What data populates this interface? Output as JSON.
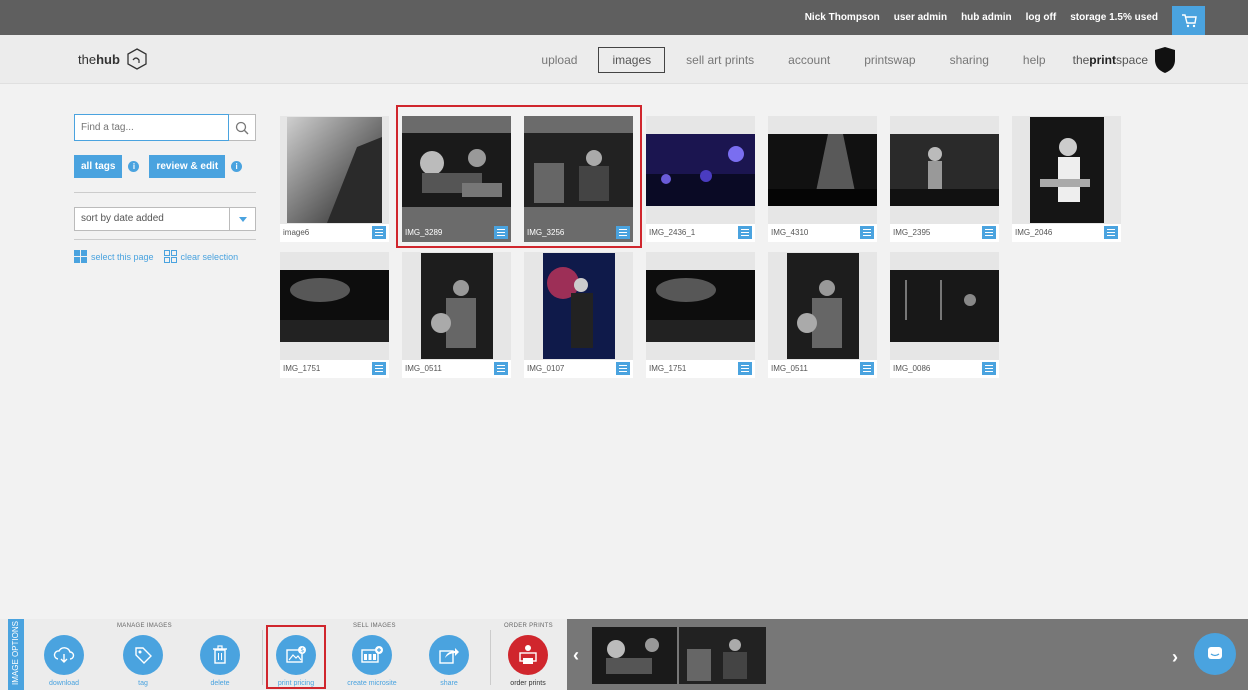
{
  "topbar": {
    "user": "Nick Thompson",
    "user_admin": "user admin",
    "hub_admin": "hub admin",
    "log_off": "log off",
    "storage": "storage 1.5% used",
    "cart_icon": "cart-icon"
  },
  "header": {
    "logo_prefix": "the",
    "logo_bold": "hub",
    "nav": [
      "upload",
      "images",
      "sell art prints",
      "account",
      "printswap",
      "sharing",
      "help"
    ],
    "active_nav": "images",
    "brand_prefix": "the",
    "brand_bold": "print",
    "brand_suffix": "space"
  },
  "sidebar": {
    "search_placeholder": "Find a tag...",
    "all_tags": "all tags",
    "review_edit": "review & edit",
    "sort_value": "sort by date added",
    "select_page": "select this page",
    "clear_selection": "clear selection"
  },
  "images": [
    {
      "name": "image6",
      "selected": false
    },
    {
      "name": "IMG_3289",
      "selected": true
    },
    {
      "name": "IMG_3256",
      "selected": true
    },
    {
      "name": "IMG_2436_1",
      "selected": false
    },
    {
      "name": "IMG_4310",
      "selected": false
    },
    {
      "name": "IMG_2395",
      "selected": false
    },
    {
      "name": "IMG_2046",
      "selected": false
    },
    {
      "name": "IMG_1751",
      "selected": false
    },
    {
      "name": "IMG_0511",
      "selected": false
    },
    {
      "name": "IMG_0107",
      "selected": false
    },
    {
      "name": "IMG_1751",
      "selected": false
    },
    {
      "name": "IMG_0511",
      "selected": false
    },
    {
      "name": "IMG_0086",
      "selected": false
    }
  ],
  "toolbar": {
    "side_tab": "IMAGE OPTIONS",
    "manage_label": "MANAGE IMAGES",
    "sell_label": "SELL IMAGES",
    "order_label": "ORDER PRINTS",
    "download": "download",
    "tag": "tag",
    "delete": "delete",
    "print_pricing": "print pricing",
    "create_microsite": "create microsite",
    "share": "share",
    "order_prints": "order prints"
  },
  "colors": {
    "accent": "#4aa3df",
    "highlight": "#d0262d",
    "topbar": "#5f5f5f"
  }
}
